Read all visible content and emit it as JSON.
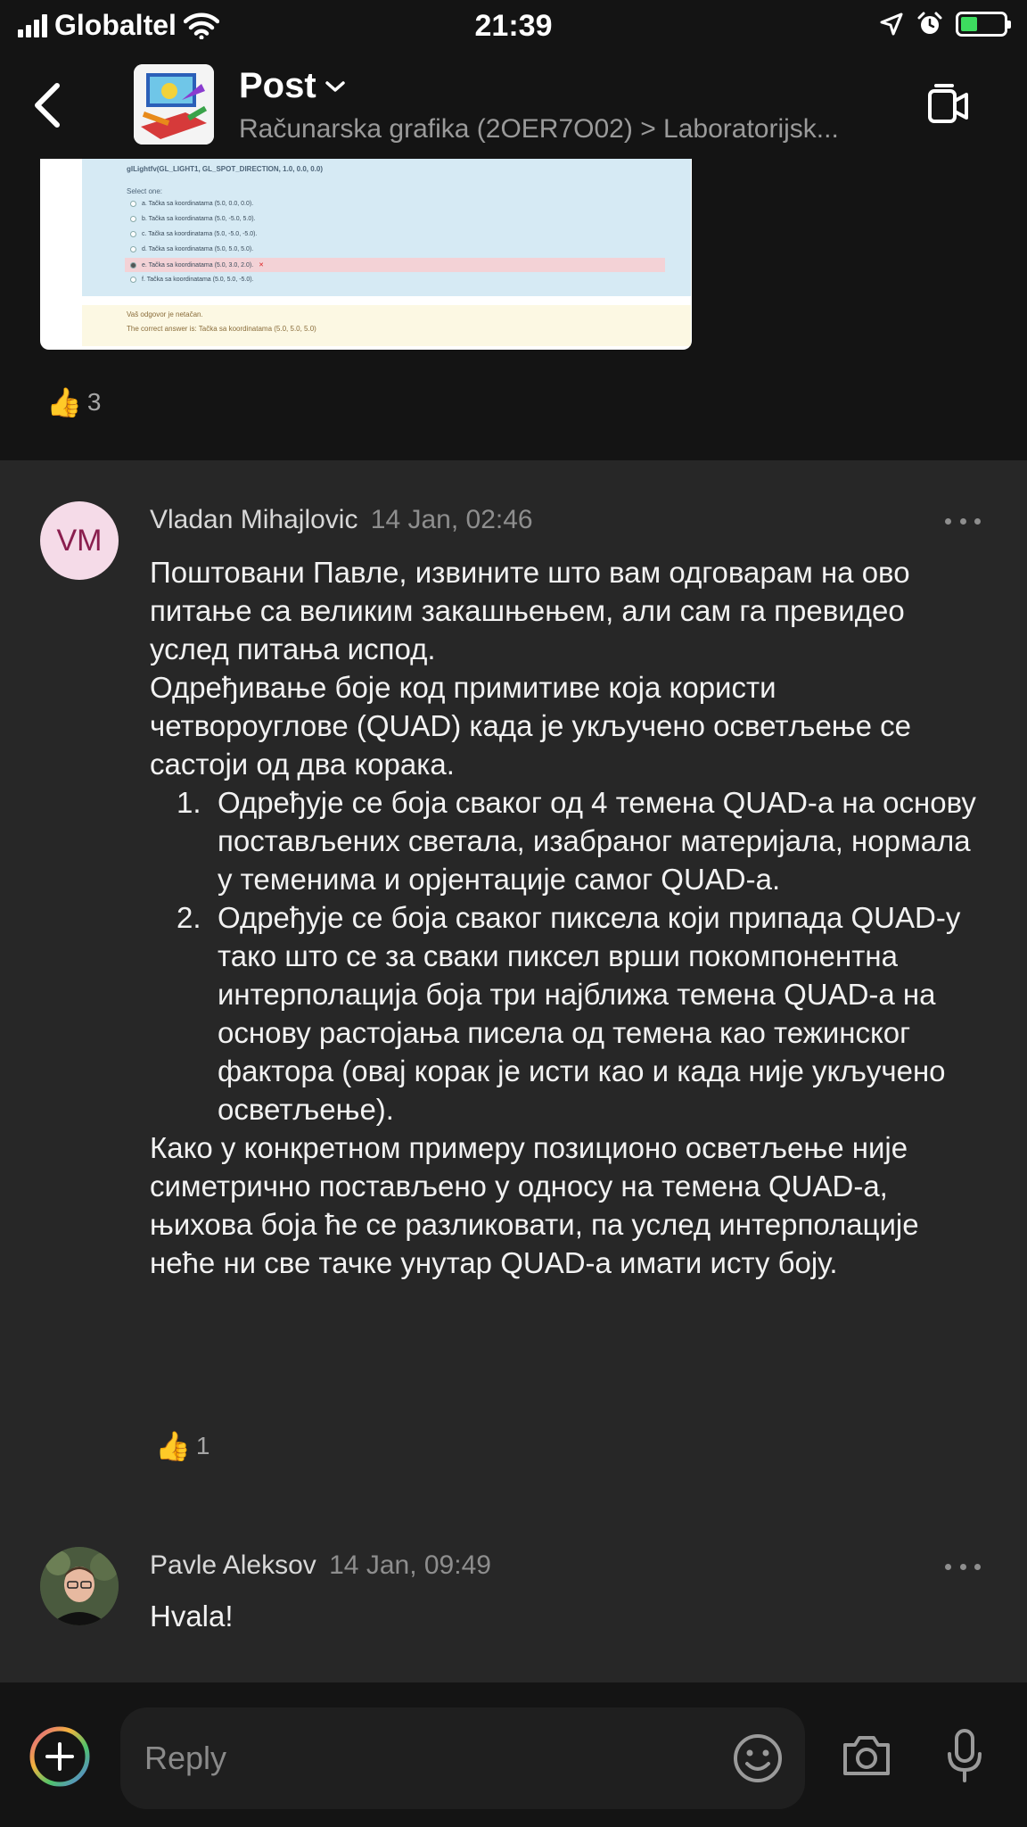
{
  "status_bar": {
    "carrier": "Globaltel",
    "time": "21:39"
  },
  "header": {
    "title": "Post",
    "breadcrumb": "Računarska grafika (2OER7O02) > Laboratorijsk..."
  },
  "quiz_image": {
    "code_line": "glLightfv(GL_LIGHT1, GL_SPOT_DIRECTION, 1.0, 0.0, 0.0)",
    "select_label": "Select one:",
    "options": [
      "a. Tačka sa koordinatama (5.0, 0.0, 0.0).",
      "b. Tačka sa koordinatama (5.0, -5.0, 5.0).",
      "c. Tačka sa koordinatama (5.0, -5.0, -5.0).",
      "d. Tačka sa koordinatama (5.0, 5.0, 5.0).",
      "e. Tačka sa koordinatama (5.0, 3.0, 2.0).",
      "f. Tačka sa koordinatama (5.0, 5.0, -5.0)."
    ],
    "feedback": "Vaš odgovor je netačan.",
    "correct_answer": "The correct answer is: Tačka sa koordinatama (5.0, 5.0, 5.0)"
  },
  "first_post": {
    "like_count": "3"
  },
  "replies": [
    {
      "initials": "VM",
      "author": "Vladan Mihajlovic",
      "time": "14 Jan, 02:46",
      "intro": "Поштовани Павле, извините што вам одговарам на ово питање са великим закашњењем, али сам га превидео услед питања испод.",
      "intro2": "Одређивање боје код примитиве која користи четвороуглове (QUAD) када је укључено осветљење се састоји од два корака.",
      "steps": [
        {
          "num": "1.",
          "text": "Одређује се боја сваког од 4 темена QUAD-а на основу постављених светала, изабраног материјала, нормала у теменима и орјентације самог QUAD-а."
        },
        {
          "num": "2.",
          "text": "Одређује се боја сваког пиксела који припада QUAD-у тако што се за сваки пиксел врши покомпонентна интерполација боја три најближа темена QUAD-а на основу растојања писела од темена као тежинског фактора (овај корак је исти као и када није укључено осветљење)."
        }
      ],
      "conclusion": "Како у конкретном примеру позиционо осветљење није симетрично постављено у односу на темена QUAD-а, њихова боја ће се разликовати, па услед интерполације неће ни све тачке унутар QUAD-а имати исту боју.",
      "like_count": "1"
    },
    {
      "author": "Pavle Aleksov",
      "time": "14 Jan, 09:49",
      "text": "Hvala!"
    }
  ],
  "composer": {
    "placeholder": "Reply"
  }
}
